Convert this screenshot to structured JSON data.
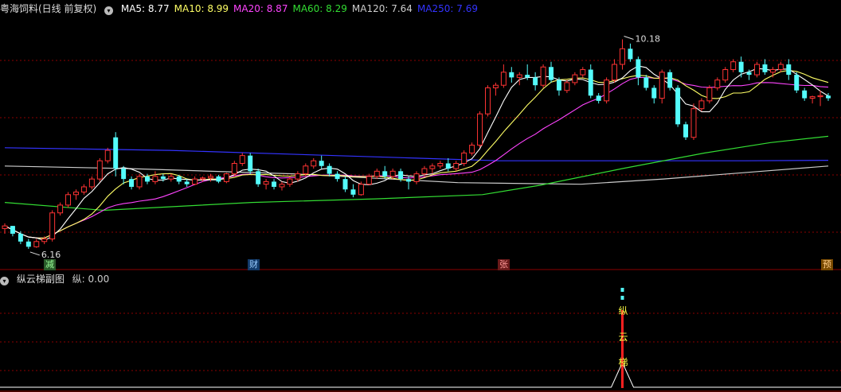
{
  "main_legend": {
    "title": "粤海饲料(日线 前复权)",
    "icon": "circle-chevron-icon",
    "ma": [
      {
        "label": "MA5: 8.77",
        "color": "#ffffff"
      },
      {
        "label": "MA10: 8.99",
        "color": "#ffff66"
      },
      {
        "label": "MA20: 8.87",
        "color": "#ff44ff"
      },
      {
        "label": "MA60: 8.29",
        "color": "#33dd33"
      },
      {
        "label": "MA120: 7.64",
        "color": "#cccccc"
      },
      {
        "label": "MA250: 7.69",
        "color": "#3333ff"
      }
    ]
  },
  "sub_legend": {
    "title": "纵云梯副图",
    "value_label": "纵: 0.00",
    "icon": "circle-chevron-icon"
  },
  "annotations": {
    "high": "10.18",
    "low": "6.16"
  },
  "markers": [
    {
      "text": "减",
      "bg": "#2a5a2a",
      "color": "#9f9"
    },
    {
      "text": "财",
      "bg": "#123a6a",
      "color": "#9cf"
    },
    {
      "text": "张",
      "bg": "#6a1a1a",
      "color": "#f99"
    },
    {
      "text": "预",
      "bg": "#7a4a00",
      "color": "#fc8"
    }
  ],
  "sub_chart_text": [
    "纵",
    "云",
    "梯"
  ],
  "colors": {
    "up": "#ff3333",
    "down": "#54fcfc",
    "grid": "#8b0000",
    "ma5": "#ffffff",
    "ma10": "#ffff66",
    "ma20": "#ff44ff",
    "ma60": "#33dd33",
    "ma120": "#cccccc",
    "ma250": "#3333ff"
  },
  "chart_data": {
    "type": "candlestick",
    "y_range": [
      5.9,
      10.6
    ],
    "candles": [
      [
        6.55,
        6.65,
        6.45,
        6.6
      ],
      [
        6.6,
        6.6,
        6.4,
        6.45
      ],
      [
        6.45,
        6.5,
        6.25,
        6.3
      ],
      [
        6.3,
        6.35,
        6.16,
        6.2
      ],
      [
        6.2,
        6.35,
        6.18,
        6.3
      ],
      [
        6.3,
        6.4,
        6.25,
        6.35
      ],
      [
        6.35,
        6.9,
        6.3,
        6.85
      ],
      [
        6.85,
        7.05,
        6.8,
        7.0
      ],
      [
        7.0,
        7.25,
        6.95,
        7.2
      ],
      [
        7.2,
        7.3,
        7.1,
        7.25
      ],
      [
        7.25,
        7.4,
        7.2,
        7.35
      ],
      [
        7.35,
        7.55,
        7.3,
        7.5
      ],
      [
        7.5,
        7.9,
        7.45,
        7.85
      ],
      [
        7.85,
        8.1,
        7.8,
        8.05
      ],
      [
        8.3,
        8.4,
        7.55,
        7.7
      ],
      [
        7.7,
        7.75,
        7.4,
        7.5
      ],
      [
        7.5,
        7.55,
        7.3,
        7.35
      ],
      [
        7.35,
        7.6,
        7.3,
        7.55
      ],
      [
        7.55,
        7.6,
        7.4,
        7.45
      ],
      [
        7.45,
        7.65,
        7.4,
        7.55
      ],
      [
        7.55,
        7.6,
        7.45,
        7.5
      ],
      [
        7.5,
        7.6,
        7.45,
        7.55
      ],
      [
        7.55,
        7.58,
        7.4,
        7.45
      ],
      [
        7.45,
        7.5,
        7.35,
        7.4
      ],
      [
        7.4,
        7.55,
        7.38,
        7.5
      ],
      [
        7.5,
        7.55,
        7.45,
        7.52
      ],
      [
        7.52,
        7.6,
        7.45,
        7.55
      ],
      [
        7.55,
        7.58,
        7.42,
        7.45
      ],
      [
        7.45,
        7.62,
        7.42,
        7.6
      ],
      [
        7.6,
        7.85,
        7.55,
        7.8
      ],
      [
        7.8,
        8.0,
        7.75,
        7.95
      ],
      [
        7.95,
        8.0,
        7.6,
        7.65
      ],
      [
        7.65,
        7.7,
        7.35,
        7.4
      ],
      [
        7.4,
        7.5,
        7.3,
        7.45
      ],
      [
        7.45,
        7.5,
        7.3,
        7.35
      ],
      [
        7.35,
        7.45,
        7.28,
        7.4
      ],
      [
        7.4,
        7.55,
        7.35,
        7.5
      ],
      [
        7.5,
        7.65,
        7.45,
        7.6
      ],
      [
        7.6,
        7.8,
        7.55,
        7.75
      ],
      [
        7.75,
        7.9,
        7.7,
        7.85
      ],
      [
        7.85,
        7.95,
        7.7,
        7.75
      ],
      [
        7.75,
        7.8,
        7.55,
        7.6
      ],
      [
        7.6,
        7.65,
        7.45,
        7.5
      ],
      [
        7.5,
        7.55,
        7.25,
        7.3
      ],
      [
        7.3,
        7.4,
        7.15,
        7.2
      ],
      [
        7.2,
        7.45,
        7.18,
        7.4
      ],
      [
        7.4,
        7.6,
        7.38,
        7.55
      ],
      [
        7.55,
        7.7,
        7.5,
        7.65
      ],
      [
        7.65,
        7.75,
        7.5,
        7.55
      ],
      [
        7.55,
        7.7,
        7.5,
        7.65
      ],
      [
        7.65,
        7.7,
        7.45,
        7.5
      ],
      [
        7.5,
        7.55,
        7.3,
        7.45
      ],
      [
        7.45,
        7.65,
        7.4,
        7.6
      ],
      [
        7.6,
        7.75,
        7.55,
        7.7
      ],
      [
        7.7,
        7.8,
        7.6,
        7.75
      ],
      [
        7.75,
        7.85,
        7.7,
        7.8
      ],
      [
        7.8,
        7.9,
        7.65,
        7.7
      ],
      [
        7.7,
        7.85,
        7.65,
        7.8
      ],
      [
        7.8,
        8.05,
        7.75,
        8.0
      ],
      [
        8.0,
        8.2,
        7.95,
        8.15
      ],
      [
        8.15,
        8.8,
        8.1,
        8.75
      ],
      [
        8.75,
        9.3,
        8.7,
        9.25
      ],
      [
        9.25,
        9.35,
        9.1,
        9.3
      ],
      [
        9.3,
        9.7,
        9.25,
        9.55
      ],
      [
        9.55,
        9.65,
        9.35,
        9.45
      ],
      [
        9.45,
        9.55,
        9.3,
        9.5
      ],
      [
        9.5,
        9.7,
        9.4,
        9.45
      ],
      [
        9.45,
        9.55,
        9.2,
        9.3
      ],
      [
        9.3,
        9.7,
        9.25,
        9.65
      ],
      [
        9.65,
        9.75,
        9.35,
        9.4
      ],
      [
        9.4,
        9.45,
        9.1,
        9.2
      ],
      [
        9.2,
        9.4,
        9.15,
        9.35
      ],
      [
        9.35,
        9.55,
        9.3,
        9.5
      ],
      [
        9.5,
        9.65,
        9.45,
        9.6
      ],
      [
        9.6,
        9.7,
        9.05,
        9.1
      ],
      [
        9.1,
        9.15,
        8.95,
        9.0
      ],
      [
        9.0,
        9.45,
        8.95,
        9.4
      ],
      [
        9.4,
        9.8,
        9.35,
        9.7
      ],
      [
        9.7,
        10.18,
        9.6,
        10.0
      ],
      [
        10.0,
        10.1,
        9.75,
        9.8
      ],
      [
        9.8,
        9.85,
        9.3,
        9.45
      ],
      [
        9.45,
        9.5,
        9.2,
        9.25
      ],
      [
        9.25,
        9.3,
        8.95,
        9.05
      ],
      [
        9.05,
        9.6,
        8.95,
        9.55
      ],
      [
        9.55,
        9.6,
        9.2,
        9.25
      ],
      [
        9.25,
        9.3,
        8.5,
        8.55
      ],
      [
        8.55,
        8.6,
        8.25,
        8.3
      ],
      [
        8.3,
        8.95,
        8.25,
        8.85
      ],
      [
        8.85,
        9.05,
        8.8,
        9.0
      ],
      [
        9.0,
        9.3,
        8.95,
        9.25
      ],
      [
        9.25,
        9.45,
        9.2,
        9.4
      ],
      [
        9.4,
        9.65,
        9.35,
        9.6
      ],
      [
        9.6,
        9.8,
        9.55,
        9.75
      ],
      [
        9.75,
        9.85,
        9.45,
        9.55
      ],
      [
        9.55,
        9.6,
        9.4,
        9.5
      ],
      [
        9.5,
        9.75,
        9.45,
        9.7
      ],
      [
        9.7,
        9.8,
        9.5,
        9.55
      ],
      [
        9.55,
        9.65,
        9.45,
        9.6
      ],
      [
        9.6,
        9.75,
        9.55,
        9.7
      ],
      [
        9.7,
        9.8,
        9.4,
        9.5
      ],
      [
        9.5,
        9.55,
        9.15,
        9.2
      ],
      [
        9.2,
        9.25,
        9.0,
        9.05
      ],
      [
        9.05,
        9.1,
        8.95,
        9.08
      ],
      [
        9.08,
        9.2,
        8.9,
        9.1
      ],
      [
        9.1,
        9.15,
        9.0,
        9.05
      ]
    ],
    "ma250": [
      [
        0,
        8.1
      ],
      [
        0.2,
        8.05
      ],
      [
        0.5,
        7.9
      ],
      [
        0.6,
        7.85
      ],
      [
        0.75,
        7.85
      ],
      [
        0.9,
        7.85
      ],
      [
        1.0,
        7.86
      ]
    ],
    "ma120": [
      [
        0,
        7.75
      ],
      [
        0.15,
        7.7
      ],
      [
        0.35,
        7.6
      ],
      [
        0.55,
        7.43
      ],
      [
        0.7,
        7.4
      ],
      [
        0.8,
        7.5
      ],
      [
        0.92,
        7.65
      ],
      [
        1.0,
        7.75
      ]
    ],
    "ma60": [
      [
        0,
        7.05
      ],
      [
        0.12,
        6.9
      ],
      [
        0.3,
        7.05
      ],
      [
        0.45,
        7.12
      ],
      [
        0.58,
        7.2
      ],
      [
        0.65,
        7.38
      ],
      [
        0.75,
        7.7
      ],
      [
        0.85,
        8.0
      ],
      [
        0.93,
        8.2
      ],
      [
        1.0,
        8.32
      ]
    ]
  }
}
